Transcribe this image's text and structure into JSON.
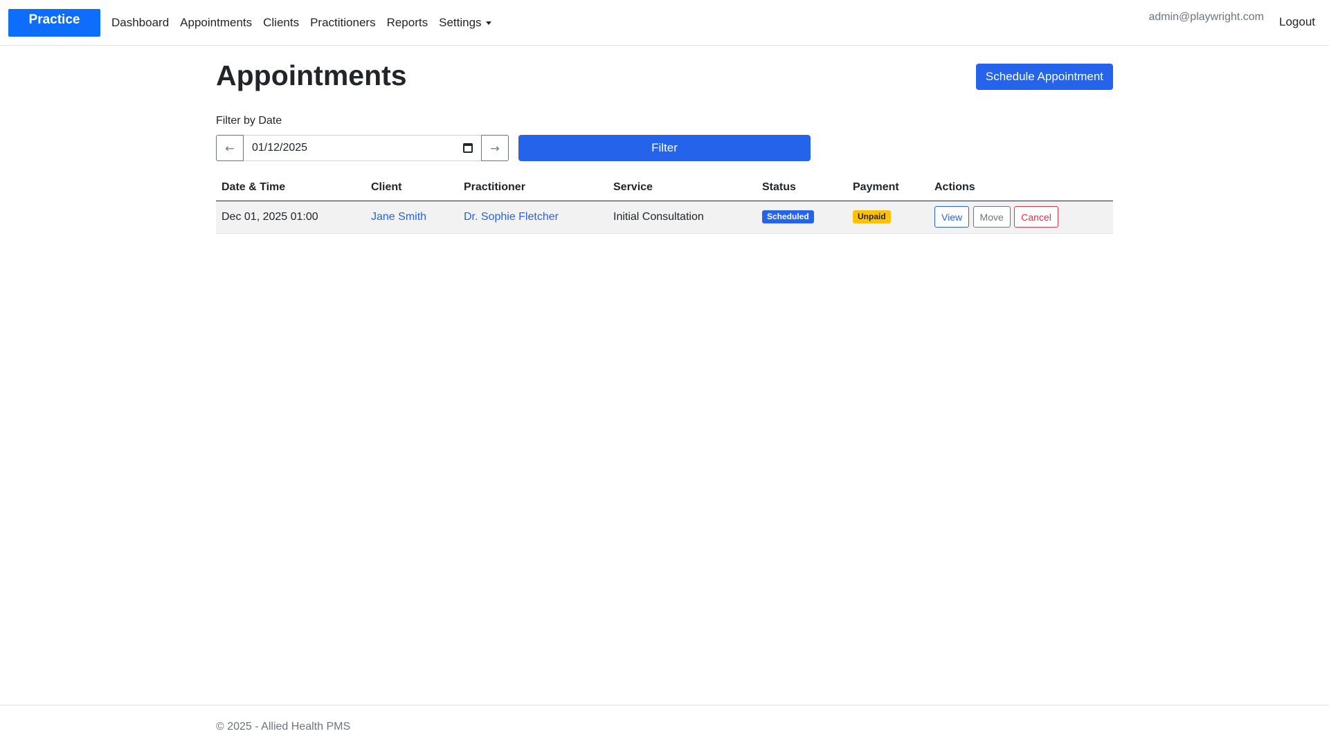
{
  "navbar": {
    "brand": "Practice",
    "links": [
      {
        "label": "Dashboard"
      },
      {
        "label": "Appointments"
      },
      {
        "label": "Clients"
      },
      {
        "label": "Practitioners"
      },
      {
        "label": "Reports"
      },
      {
        "label": "Settings"
      }
    ],
    "user_email": "admin@playwright.com",
    "logout": "Logout"
  },
  "page": {
    "title": "Appointments",
    "schedule_button": "Schedule Appointment"
  },
  "filter": {
    "label": "Filter by Date",
    "date_value": "01/12/2025",
    "prev_arrow": "←",
    "next_arrow": "→",
    "button": "Filter"
  },
  "table": {
    "headers": [
      "Date & Time",
      "Client",
      "Practitioner",
      "Service",
      "Status",
      "Payment",
      "Actions"
    ],
    "rows": [
      {
        "datetime": "Dec 01, 2025 01:00",
        "client": "Jane Smith",
        "practitioner": "Dr. Sophie Fletcher",
        "service": "Initial Consultation",
        "status": "Scheduled",
        "payment": "Unpaid",
        "actions": {
          "view": "View",
          "move": "Move",
          "cancel": "Cancel"
        }
      }
    ]
  },
  "footer": {
    "text": "© 2025 - Allied Health PMS"
  },
  "colors": {
    "brand": "#0d6efd",
    "primary": "#2563eb",
    "warning": "#ffc107",
    "danger": "#dc3545",
    "secondary": "#6c757d"
  },
  "icons": {
    "calendar": "calendar-icon",
    "settings_caret": "chevron-down-icon"
  }
}
